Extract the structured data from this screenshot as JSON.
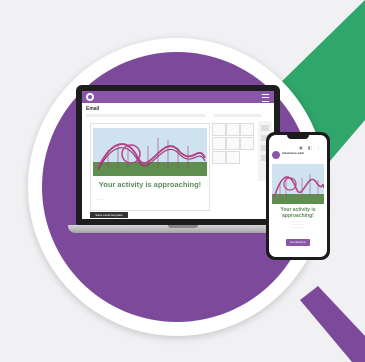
{
  "colors": {
    "brand_purple": "#7d4a9b",
    "accent_green": "#2fa66a",
    "headline_green": "#5d8a5d",
    "badge_white": "#ffffff"
  },
  "laptop": {
    "app_title": "Email",
    "headline": "Your activity is approaching!",
    "save_button": "Save email template"
  },
  "phone": {
    "sender": "Adventure park",
    "headline": "Your activity is approaching!",
    "button": "Get directions"
  },
  "icons": {
    "app_logo": "logo-icon",
    "menu": "menu-icon"
  }
}
